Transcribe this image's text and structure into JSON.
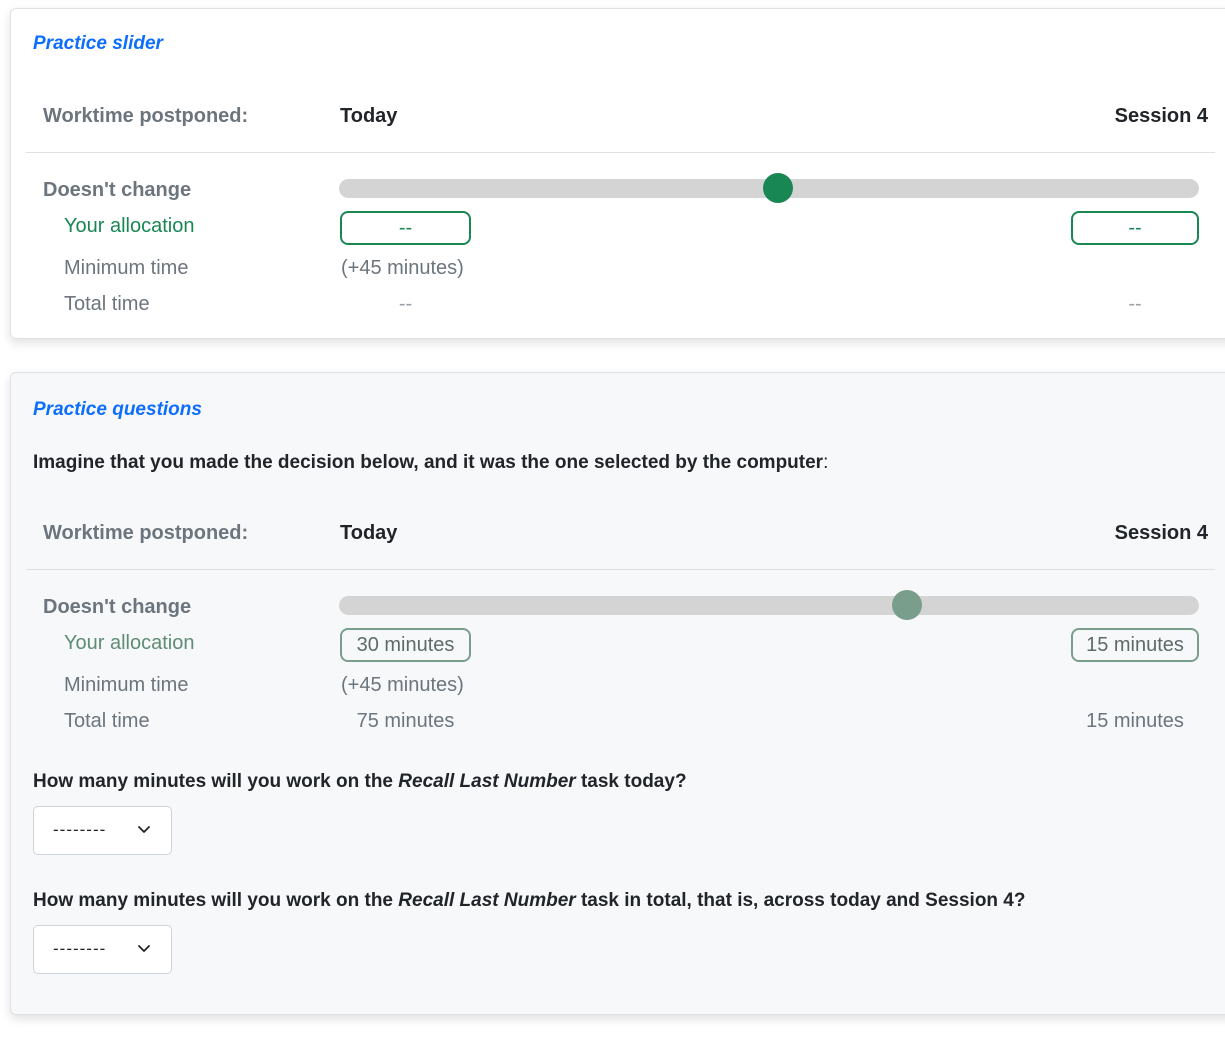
{
  "slider_card": {
    "title": "Practice slider",
    "header_label": "Worktime postponed:",
    "col_today": "Today",
    "col_session": "Session 4",
    "doesnt_change": "Doesn't change",
    "slider_value": 0.51,
    "thumb_color": "#198754",
    "rows": {
      "allocation_label": "Your allocation",
      "allocation_today": "--",
      "allocation_session": "--",
      "minimum_label": "Minimum time",
      "minimum_today": "(+45 minutes)",
      "total_label": "Total time",
      "total_today": "--",
      "total_session": "--"
    }
  },
  "questions_card": {
    "title": "Practice questions",
    "intro_bold": "Imagine that you made the decision below, and it was the one selected by the computer",
    "intro_colon": ":",
    "header_label": "Worktime postponed:",
    "col_today": "Today",
    "col_session": "Session 4",
    "doesnt_change": "Doesn't change",
    "slider_value": 0.66,
    "thumb_color": "#7a9e8c",
    "rows": {
      "allocation_label": "Your allocation",
      "allocation_today": "30 minutes",
      "allocation_session": "15 minutes",
      "minimum_label": "Minimum time",
      "minimum_today": "(+45 minutes)",
      "total_label": "Total time",
      "total_today": "75 minutes",
      "total_session": "15 minutes"
    },
    "q1": {
      "prefix": "How many minutes will you work on the ",
      "task": "Recall Last Number",
      "suffix": " task today?",
      "select_value": "--------"
    },
    "q2": {
      "prefix": "How many minutes will you work on the ",
      "task": "Recall Last Number",
      "suffix": " task in total, that is, across today and Session 4?",
      "select_value": "--------"
    }
  },
  "colors": {
    "title_blue": "#0d6efd",
    "allocation_green": "#198754",
    "muted_green": "#5e8c74"
  }
}
